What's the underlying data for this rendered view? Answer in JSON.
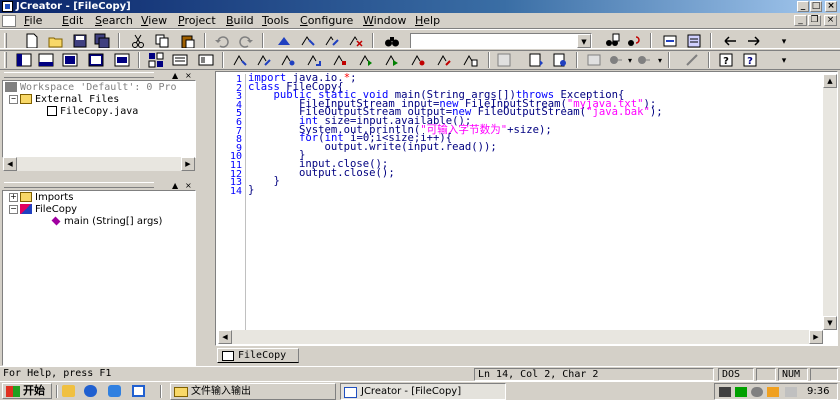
{
  "window": {
    "title": "JCreator - [FileCopy]",
    "caption_minimize": "_",
    "caption_maximize": "□",
    "caption_close": "×"
  },
  "menu": {
    "items": [
      {
        "label": "File",
        "mnemonic": "F",
        "rest": "ile"
      },
      {
        "label": "Edit",
        "mnemonic": "E",
        "rest": "dit"
      },
      {
        "label": "Search",
        "mnemonic": "S",
        "rest": "earch"
      },
      {
        "label": "View",
        "mnemonic": "V",
        "rest": "iew"
      },
      {
        "label": "Project",
        "mnemonic": "P",
        "rest": "roject"
      },
      {
        "label": "Build",
        "mnemonic": "B",
        "rest": "uild"
      },
      {
        "label": "Tools",
        "mnemonic": "T",
        "rest": "ools"
      },
      {
        "label": "Configure",
        "mnemonic": "C",
        "rest": "onfigure"
      },
      {
        "label": "Window",
        "mnemonic": "W",
        "rest": "indow"
      },
      {
        "label": "Help",
        "mnemonic": "H",
        "rest": "elp"
      }
    ],
    "mdi_minimize": "_",
    "mdi_restore": "❐",
    "mdi_close": "×"
  },
  "toolbar": {
    "search_value": ""
  },
  "workspace": {
    "root_label": "Workspace 'Default': 0 Pro",
    "folder_label": "External Files",
    "file_label": "FileCopy.java",
    "pane_minimize": "▲",
    "pane_close": "×"
  },
  "classes": {
    "imports_label": "Imports",
    "class_label": "FileCopy",
    "method_label": "main (String[] args)",
    "pane_minimize": "▲",
    "pane_close": "×"
  },
  "editor": {
    "line_numbers": [
      "1",
      "2",
      "3",
      "4",
      "5",
      "6",
      "7",
      "8",
      "9",
      "10",
      "11",
      "12",
      "13",
      "14"
    ],
    "tab_label": "FileCopy"
  },
  "status": {
    "help_text": "For Help, press F1",
    "position": "Ln 14, Col 2, Char 2",
    "dos": "DOS",
    "num": "NUM"
  },
  "taskbar": {
    "start_label": "开始",
    "tasks": [
      {
        "label": "文件输入输出"
      },
      {
        "label": "JCreator - [FileCopy]"
      }
    ],
    "clock": "9:36"
  }
}
